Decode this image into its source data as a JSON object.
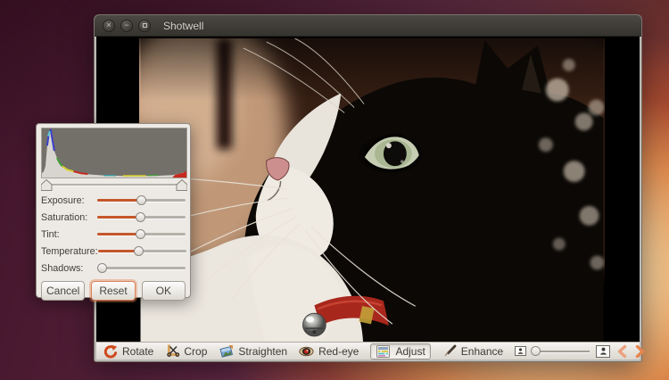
{
  "window": {
    "title": "Shotwell",
    "controls": [
      {
        "name": "close-icon",
        "glyph": "×"
      },
      {
        "name": "minimize-icon",
        "glyph": "−"
      },
      {
        "name": "maximize-icon",
        "glyph": ""
      }
    ]
  },
  "adjust_dialog": {
    "histogram": {
      "channels": [
        "red",
        "green",
        "blue"
      ],
      "peak_position_pct": 7
    },
    "range": {
      "left_pct": 0,
      "right_pct": 100
    },
    "sliders": [
      {
        "label": "Exposure:",
        "value_pct": 50
      },
      {
        "label": "Saturation:",
        "value_pct": 49
      },
      {
        "label": "Tint:",
        "value_pct": 49
      },
      {
        "label": "Temperature:",
        "value_pct": 47
      },
      {
        "label": "Shadows:",
        "value_pct": 6
      }
    ],
    "buttons": [
      {
        "label": "Cancel"
      },
      {
        "label": "Reset",
        "focused": true
      },
      {
        "label": "OK"
      }
    ]
  },
  "toolbar": {
    "buttons": [
      {
        "label": "Rotate",
        "icon": "rotate-icon"
      },
      {
        "label": "Crop",
        "icon": "crop-icon"
      },
      {
        "label": "Straighten",
        "icon": "straighten-icon"
      },
      {
        "label": "Red-eye",
        "icon": "red-eye-icon"
      },
      {
        "label": "Adjust",
        "icon": "adjust-icon",
        "active": true
      },
      {
        "label": "Enhance",
        "icon": "enhance-icon"
      }
    ],
    "zoom_slider": {
      "value_pct": 5
    }
  },
  "colors": {
    "accent_orange": "#c4572b",
    "titlebar": "#3e3b36",
    "dialog_bg": "#edeae5",
    "chevron": "#e7854f"
  }
}
